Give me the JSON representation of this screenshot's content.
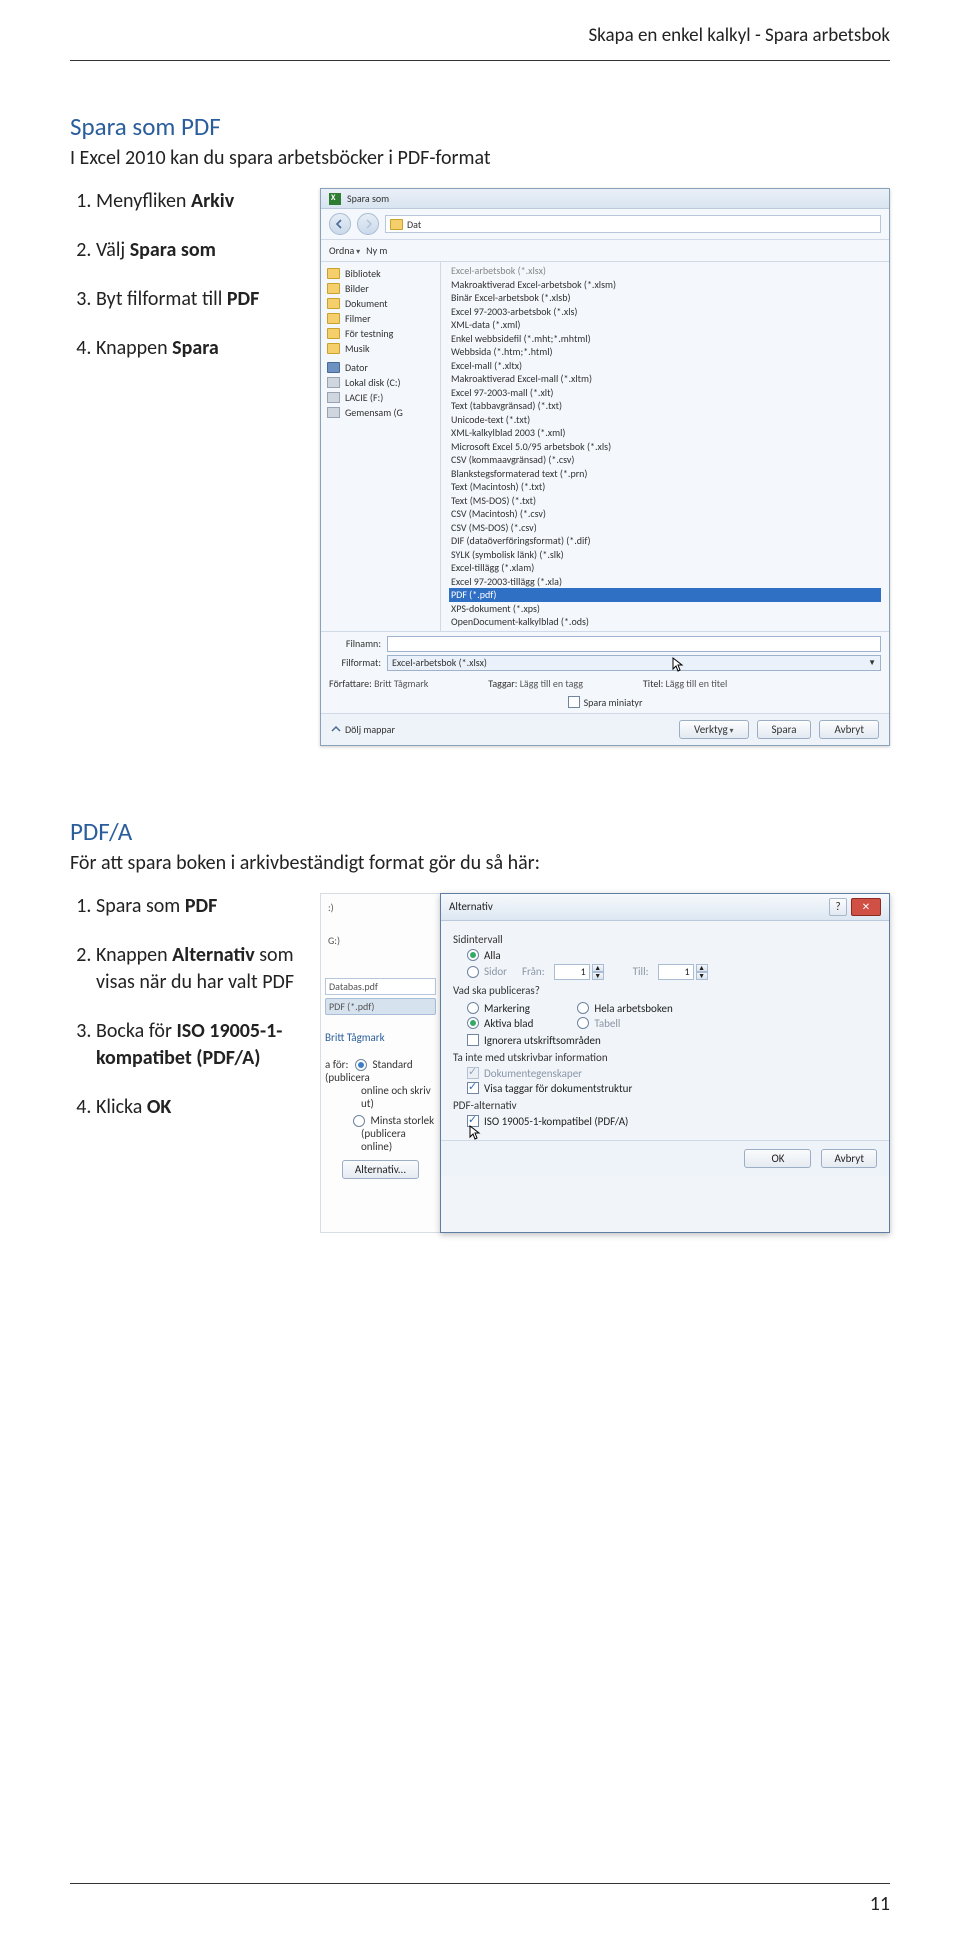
{
  "header": {
    "right": "Skapa en enkel kalkyl - Spara arbetsbok"
  },
  "section1": {
    "title": "Spara som PDF",
    "intro": "I Excel 2010 kan du spara arbetsböcker i PDF-format",
    "steps": [
      {
        "pre": "Menyfliken ",
        "bold": "Arkiv",
        "post": ""
      },
      {
        "pre": "Välj ",
        "bold": "Spara som",
        "post": ""
      },
      {
        "pre": "Byt filformat till ",
        "bold": "PDF",
        "post": ""
      },
      {
        "pre": "Knappen ",
        "bold": "Spara",
        "post": ""
      }
    ]
  },
  "saveDialog": {
    "title": "Spara som",
    "ordnaLabel": "Ordna",
    "nyLabel": "Ny m",
    "locationLabel": "Dat",
    "sidebar": [
      "Bibliotek",
      "Bilder",
      "Dokument",
      "Filmer",
      "För testning",
      "Musik",
      "Dator",
      "Lokal disk (C:)",
      "LACIE (F:)",
      "Gemensam (G"
    ],
    "formats": [
      "Excel-arbetsbok (*.xlsx)",
      "Makroaktiverad Excel-arbetsbok (*.xlsm)",
      "Binär Excel-arbetsbok (*.xlsb)",
      "Excel 97-2003-arbetsbok (*.xls)",
      "XML-data (*.xml)",
      "Enkel webbsidefil (*.mht;*.mhtml)",
      "Webbsida (*.htm;*.html)",
      "Excel-mall (*.xltx)",
      "Makroaktiverad Excel-mall (*.xltm)",
      "Excel 97-2003-mall (*.xlt)",
      "Text (tabbavgränsad) (*.txt)",
      "Unicode-text (*.txt)",
      "XML-kalkylblad 2003 (*.xml)",
      "Microsoft Excel 5.0/95 arbetsbok (*.xls)",
      "CSV (kommaavgränsad) (*.csv)",
      "Blankstegsformaterad text (*.prn)",
      "Text (Macintosh) (*.txt)",
      "Text (MS-DOS) (*.txt)",
      "CSV (Macintosh) (*.csv)",
      "CSV (MS-DOS) (*.csv)",
      "DIF (dataöverföringsformat) (*.dif)",
      "SYLK (symbolisk länk) (*.slk)",
      "Excel-tillägg (*.xlam)",
      "Excel 97-2003-tillägg (*.xla)",
      "PDF (*.pdf)",
      "XPS-dokument (*.xps)",
      "OpenDocument-kalkylblad (*.ods)"
    ],
    "filnamnLabel": "Filnamn:",
    "filformatLabel": "Filformat:",
    "filformatValue": "Excel-arbetsbok (*.xlsx)",
    "authorLabel": "Författare:",
    "authorValue": "Britt Tågmark",
    "tagsLabel": "Taggar:",
    "tagsValue": "Lägg till en tagg",
    "titleLabel": "Titel:",
    "titleValue": "Lägg till en titel",
    "miniThumb": "Spara miniatyr",
    "hideFolders": "Dölj mappar",
    "toolsBtn": "Verktyg",
    "saveBtn": "Spara",
    "cancelBtn": "Avbryt"
  },
  "section2": {
    "title": "PDF/A",
    "intro": "För att spara boken i arkivbeständigt format gör du så här:",
    "steps": [
      {
        "pre": "Spara som ",
        "bold": "PDF",
        "post": ""
      },
      {
        "pre": "Knappen ",
        "bold": "Alternativ",
        "post": " som visas när du har valt PDF"
      },
      {
        "pre": "Bocka för ",
        "bold": "ISO 19005-1-kompatibet (PDF/A)",
        "post": ""
      },
      {
        "pre": "Klicka ",
        "bold": "OK",
        "post": ""
      }
    ]
  },
  "bgFrag": {
    "coll": ":)",
    "g": "G:)",
    "file": "Databas.pdf",
    "format": "PDF (*.pdf)",
    "author": "Britt Tågmark",
    "optFor": "a för:",
    "opt1a": "Standard (publicera",
    "opt1b": "online och skriv ut)",
    "opt2a": "Minsta storlek",
    "opt2b": "(publicera online)",
    "altBtn": "Alternativ..."
  },
  "altDialog": {
    "title": "Alternativ",
    "grpPages": "Sidintervall",
    "radioAll": "Alla",
    "radioPages": "Sidor",
    "fromLbl": "Från:",
    "fromVal": "1",
    "toLbl": "Till:",
    "toVal": "1",
    "grpPublish": "Vad ska publiceras?",
    "radioSel": "Markering",
    "radioActive": "Aktiva blad",
    "radioWhole": "Hela arbetsboken",
    "radioTable": "Tabell",
    "chkIgnore": "Ignorera utskriftsområden",
    "grpNonPrint": "Ta inte med utskrivbar information",
    "chkDocProps": "Dokumentegenskaper",
    "chkTags": "Visa taggar för dokumentstruktur",
    "grpPdfAlt": "PDF-alternativ",
    "chkIso": "ISO 19005-1-kompatibel (PDF/A)",
    "okBtn": "OK",
    "cancelBtn": "Avbryt"
  },
  "footer": {
    "pageNum": "11"
  }
}
